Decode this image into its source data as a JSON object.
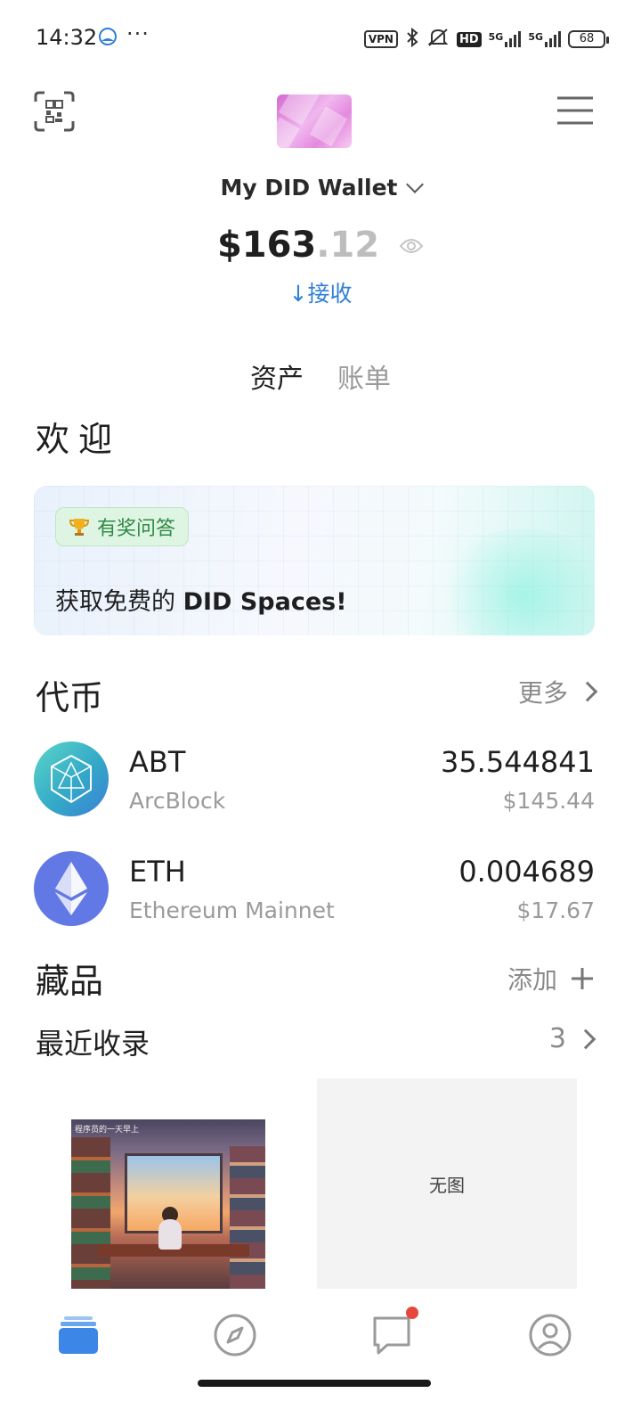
{
  "status_bar": {
    "time": "14:32",
    "dots": "···",
    "vpn": "VPN",
    "hd": "HD",
    "net1": "5G",
    "net2": "5G",
    "battery": "68"
  },
  "header": {
    "wallet_name": "My DID Wallet",
    "balance_main": "$163",
    "balance_cents": ".12",
    "receive_label": "↓接收"
  },
  "tabs": [
    {
      "label": "资产",
      "active": true
    },
    {
      "label": "账单",
      "active": false
    }
  ],
  "welcome": {
    "title": "欢迎",
    "promo_tag": "有奖问答",
    "promo_text_prefix": "获取免费的 ",
    "promo_text_bold": "DID Spaces!"
  },
  "tokens_section": {
    "title": "代币",
    "more_label": "更多",
    "items": [
      {
        "symbol": "ABT",
        "network": "ArcBlock",
        "amount": "35.544841",
        "usd": "$145.44",
        "icon": "arcblock-icon"
      },
      {
        "symbol": "ETH",
        "network": "Ethereum Mainnet",
        "amount": "0.004689",
        "usd": "$17.67",
        "icon": "ethereum-icon"
      }
    ]
  },
  "collectibles_section": {
    "title": "藏品",
    "add_label": "添加",
    "recent_label": "最近收录",
    "recent_count": "3",
    "nft_caption": "程序员的一天早上",
    "no_image_label": "无图"
  },
  "bottom_nav": [
    {
      "name": "wallet",
      "icon": "wallet-icon",
      "active": true
    },
    {
      "name": "discover",
      "icon": "compass-icon",
      "active": false
    },
    {
      "name": "messages",
      "icon": "chat-icon",
      "active": false,
      "badge": true
    },
    {
      "name": "profile",
      "icon": "user-icon",
      "active": false
    }
  ],
  "colors": {
    "accent": "#2f7fd6",
    "active_nav": "#3b86e6",
    "badge": "#e8483c"
  }
}
